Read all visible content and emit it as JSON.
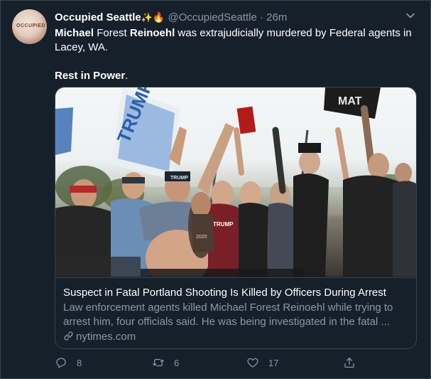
{
  "tweet": {
    "display_name": "Occupied Seattle",
    "handle": "@OccupiedSeattle",
    "separator": "·",
    "time": "26m",
    "avatar_text": "OCCUPIED",
    "text_line1_bold1": "Michael",
    "text_line1_mid": " Forest ",
    "text_line1_bold2": "Reinoehl",
    "text_line1_rest": " was extrajudicially murdered by Federal agents in Lacey, WA.",
    "text_line2_bold": "Rest in Power",
    "text_line2_rest": "."
  },
  "card": {
    "title": "Suspect in Fatal Portland Shooting Is Killed by Officers During Arrest",
    "description": "Law enforcement agents killed Michael Forest Reinoehl while trying to arrest him, four officials said. He was being investigated in the fatal ...",
    "domain": "nytimes.com",
    "image_signs": [
      "TRUMP",
      "MAT",
      "TRUMP",
      "TRUMP",
      "2020"
    ]
  },
  "actions": {
    "reply_count": "8",
    "retweet_count": "6",
    "like_count": "17"
  },
  "icons": {
    "menu": "chevron-down-icon",
    "reply": "reply-icon",
    "retweet": "retweet-icon",
    "like": "heart-icon",
    "share": "share-icon",
    "link": "link-icon"
  },
  "colors": {
    "background": "#15202b",
    "border": "#38444d",
    "secondary_text": "#8899a6",
    "primary_text": "#ffffff"
  }
}
